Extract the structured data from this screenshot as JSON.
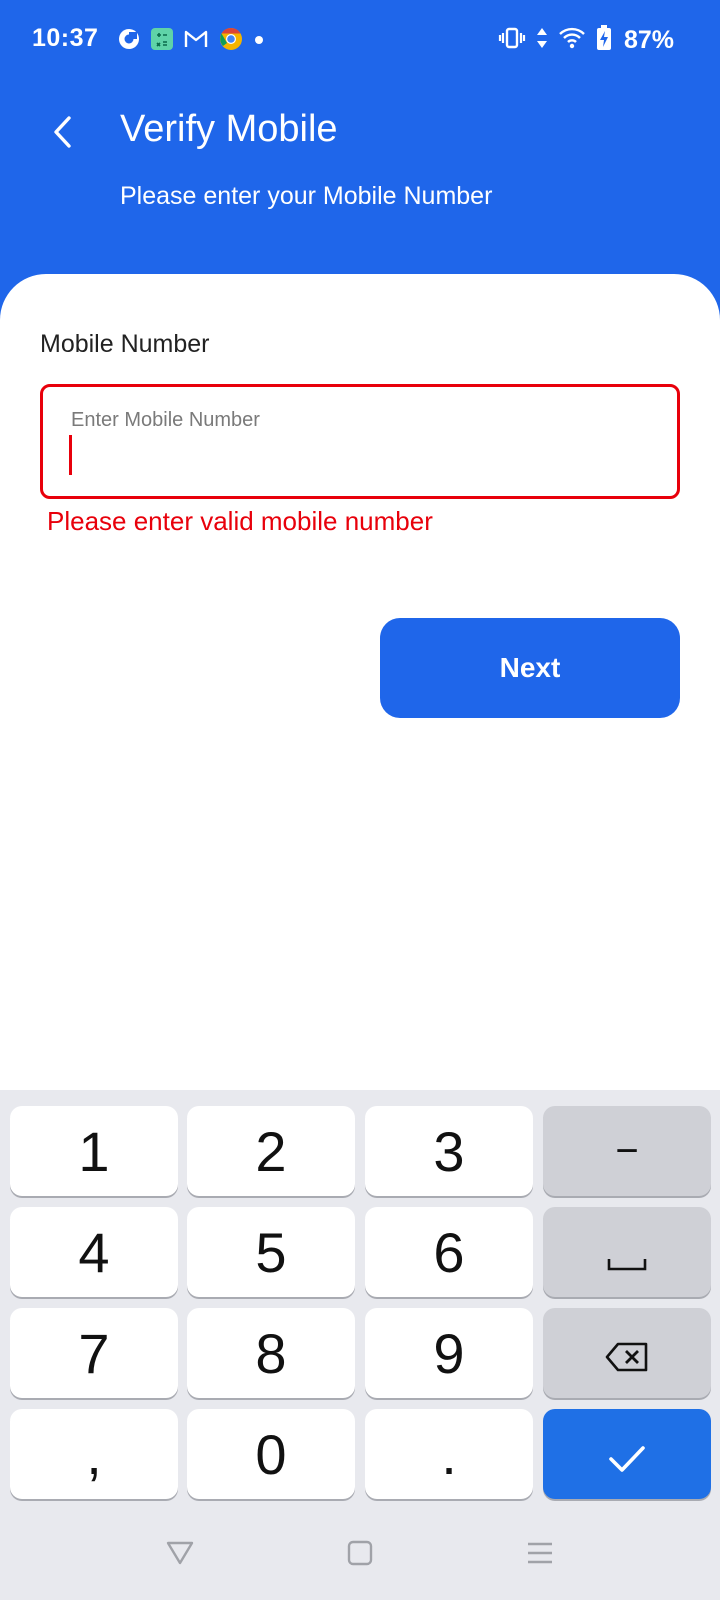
{
  "status_bar": {
    "time": "10:37",
    "battery": "87%",
    "notification_icons": [
      "app-c-icon",
      "calculator-icon",
      "gmail-icon",
      "chrome-icon",
      "dot-icon"
    ],
    "system_icons": [
      "vibrate-icon",
      "data-arrows-icon",
      "wifi-icon",
      "battery-icon"
    ]
  },
  "header": {
    "title": "Verify Mobile",
    "subtitle": "Please enter your Mobile Number"
  },
  "form": {
    "label": "Mobile Number",
    "placeholder": "Enter Mobile Number",
    "value": "",
    "error": "Please enter valid mobile number",
    "next_label": "Next"
  },
  "keyboard": {
    "keys": [
      "1",
      "2",
      "3",
      "−",
      "4",
      "5",
      "6",
      "space",
      "7",
      "8",
      "9",
      "backspace",
      ",",
      "0",
      ".",
      "done"
    ],
    "k1": "1",
    "k2": "2",
    "k3": "3",
    "k_minus": "−",
    "k4": "4",
    "k5": "5",
    "k6": "6",
    "k7": "7",
    "k8": "8",
    "k9": "9",
    "k_comma": ",",
    "k0": "0",
    "k_period": "."
  },
  "colors": {
    "primary": "#1f66ea",
    "error": "#e8000b",
    "keyboard_bg": "#e8e9ee"
  }
}
